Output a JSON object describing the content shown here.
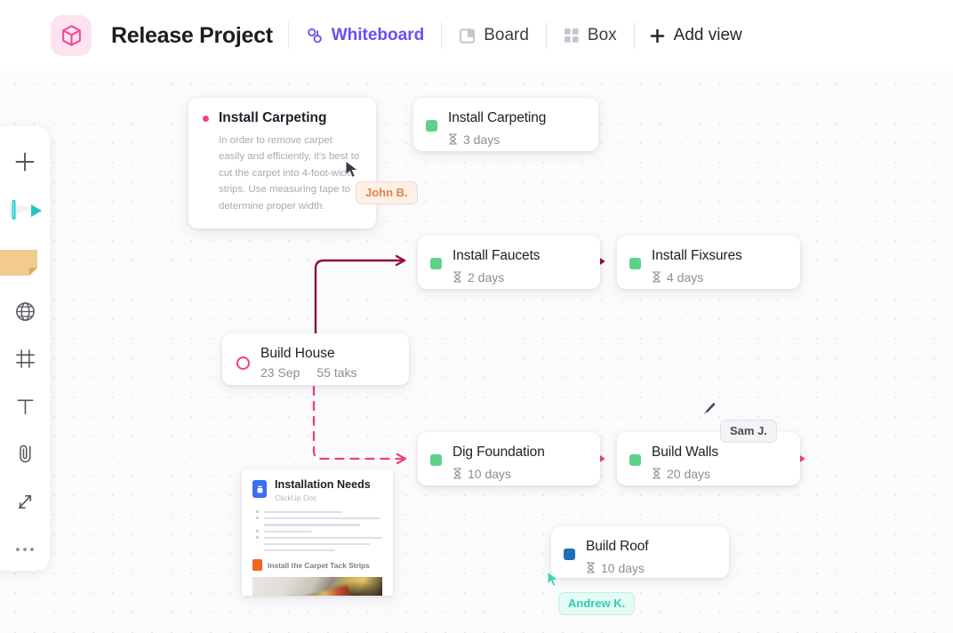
{
  "header": {
    "logo_icon": "cube-icon",
    "project_title": "Release Project",
    "views": [
      {
        "label": "Whiteboard",
        "icon": "whiteboard-icon",
        "active": true
      },
      {
        "label": "Board",
        "icon": "board-columns-icon",
        "active": false
      },
      {
        "label": "Box",
        "icon": "box-grid-icon",
        "active": false
      }
    ],
    "add_view_label": "Add view",
    "add_view_icon": "plus-icon",
    "active_color": "#6b4df6"
  },
  "toolbar": {
    "items": [
      {
        "name": "add-tool",
        "icon": "plus-icon"
      },
      {
        "name": "draw-tool",
        "icon": "pen-cursor-icon"
      },
      {
        "name": "sticky-note-tool",
        "icon": "sticky-note-icon"
      },
      {
        "name": "web-tool",
        "icon": "globe-icon"
      },
      {
        "name": "frame-tool",
        "icon": "frame-icon"
      },
      {
        "name": "text-tool",
        "icon": "text-T-icon"
      },
      {
        "name": "attach-tool",
        "icon": "paperclip-icon"
      },
      {
        "name": "connector-tool",
        "icon": "connector-arrows-icon"
      },
      {
        "name": "more-tool",
        "icon": "ellipsis-icon"
      }
    ]
  },
  "canvas": {
    "note_card": {
      "title": "Install Carpeting",
      "body": "In order to remove carpet easily and efficiently, it's best to cut the carpet into 4-foot-wide strips. Use measuring tape to determine proper width.",
      "bullet_color": "#f0407f"
    },
    "build_house": {
      "title": "Build House",
      "date": "23 Sep",
      "tasks": "55 taks",
      "ring_color": "#f0407f"
    },
    "task_cards": [
      {
        "title": "Install Carpeting",
        "duration": "3 days",
        "duration_icon": "hourglass-icon",
        "status_color": "#5fd08a"
      },
      {
        "title": "Install Faucets",
        "duration": "2 days",
        "duration_icon": "hourglass-icon",
        "status_color": "#5fd08a"
      },
      {
        "title": "Install Fixsures",
        "duration": "4 days",
        "duration_icon": "hourglass-icon",
        "status_color": "#5fd08a"
      },
      {
        "title": "Dig Foundation",
        "duration": "10 days",
        "duration_icon": "hourglass-icon",
        "status_color": "#5fd08a"
      },
      {
        "title": "Build Walls",
        "duration": "20 days",
        "duration_icon": "hourglass-icon",
        "status_color": "#5fd08a"
      },
      {
        "title": "Build Roof",
        "duration": "10 days",
        "duration_icon": "hourglass-icon",
        "status_color": "#1f6fb8"
      }
    ],
    "doc_card": {
      "title": "Installation Needs",
      "subtitle": "ClickUp Doc",
      "section_heading": "Install the Carpet Tack Strips",
      "icon": "doc-icon"
    },
    "cursors": [
      {
        "name": "John B.",
        "style": "john",
        "icon": "arrow-cursor-icon"
      },
      {
        "name": "Sam J.",
        "style": "sam",
        "icon": "pen-cursor-icon"
      },
      {
        "name": "Andrew K.",
        "style": "andrew",
        "icon": "arrow-cursor-icon"
      }
    ],
    "connector_colors": {
      "solid": "#8c1137",
      "dashed": "#ef3f7d"
    }
  }
}
